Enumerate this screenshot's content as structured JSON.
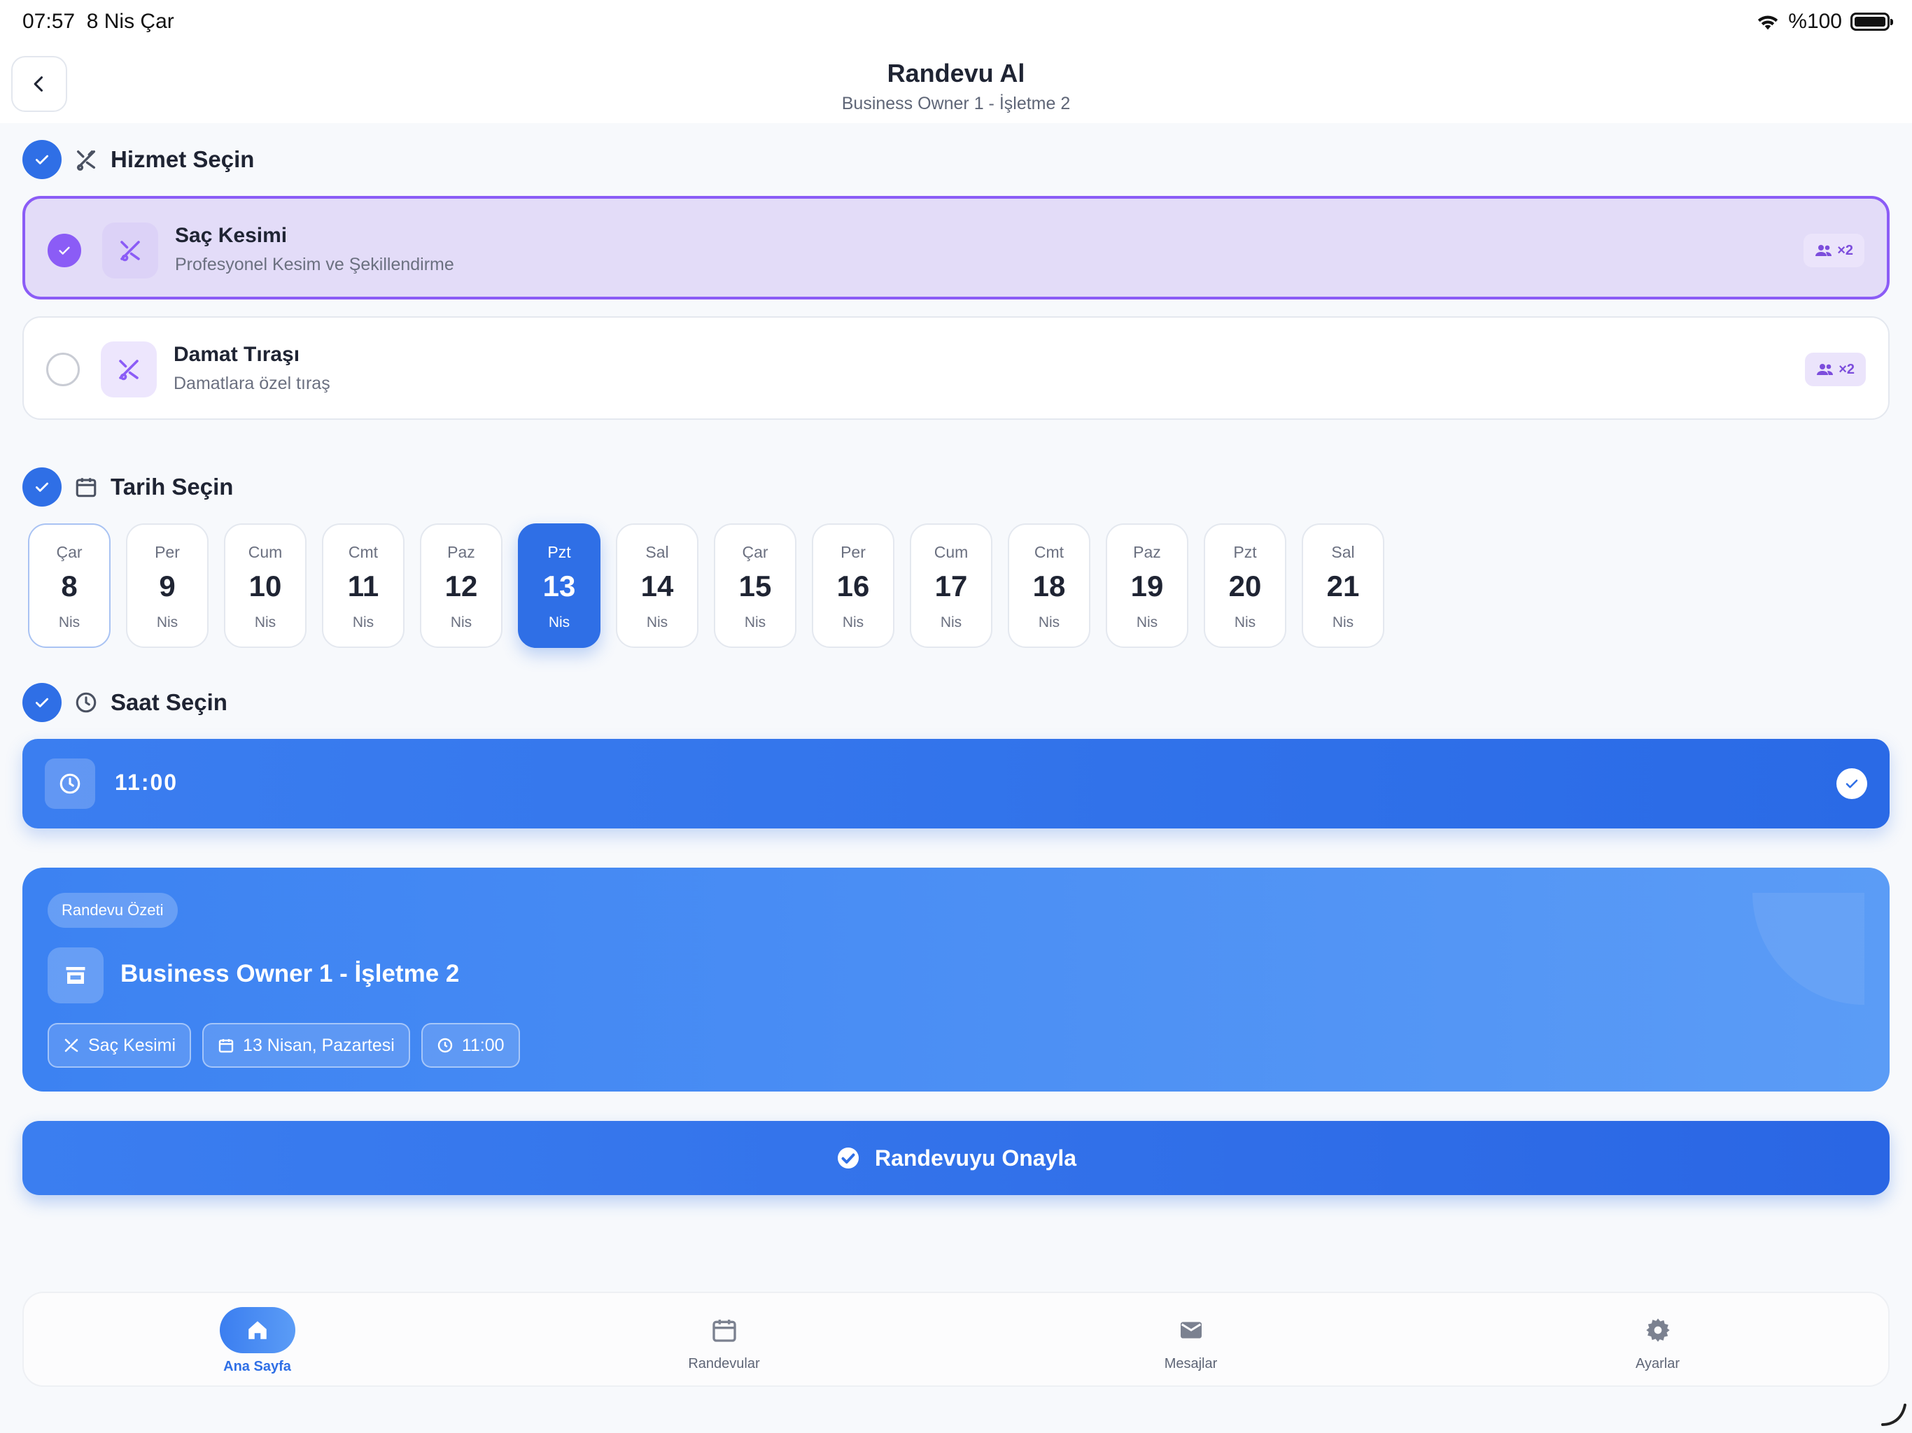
{
  "status": {
    "time": "07:57",
    "date": "8 Nis Çar",
    "battery": "%100"
  },
  "header": {
    "title": "Randevu Al",
    "subtitle": "Business Owner 1 - İşletme 2"
  },
  "sections": {
    "service": "Hizmet Seçin",
    "date": "Tarih Seçin",
    "time": "Saat Seçin"
  },
  "services": [
    {
      "name": "Saç Kesimi",
      "desc": "Profesyonel Kesim ve Şekillendirme",
      "badge": "×2",
      "selected": true
    },
    {
      "name": "Damat Tıraşı",
      "desc": "Damatlara özel tıraş",
      "badge": "×2",
      "selected": false
    }
  ],
  "dates": [
    {
      "dw": "Çar",
      "dn": "8",
      "dm": "Nis"
    },
    {
      "dw": "Per",
      "dn": "9",
      "dm": "Nis"
    },
    {
      "dw": "Cum",
      "dn": "10",
      "dm": "Nis"
    },
    {
      "dw": "Cmt",
      "dn": "11",
      "dm": "Nis"
    },
    {
      "dw": "Paz",
      "dn": "12",
      "dm": "Nis"
    },
    {
      "dw": "Pzt",
      "dn": "13",
      "dm": "Nis"
    },
    {
      "dw": "Sal",
      "dn": "14",
      "dm": "Nis"
    },
    {
      "dw": "Çar",
      "dn": "15",
      "dm": "Nis"
    },
    {
      "dw": "Per",
      "dn": "16",
      "dm": "Nis"
    },
    {
      "dw": "Cum",
      "dn": "17",
      "dm": "Nis"
    },
    {
      "dw": "Cmt",
      "dn": "18",
      "dm": "Nis"
    },
    {
      "dw": "Paz",
      "dn": "19",
      "dm": "Nis"
    },
    {
      "dw": "Pzt",
      "dn": "20",
      "dm": "Nis"
    },
    {
      "dw": "Sal",
      "dn": "21",
      "dm": "Nis"
    }
  ],
  "selected_time": "11:00",
  "summary": {
    "pill": "Randevu Özeti",
    "business": "Business Owner 1 - İşletme 2",
    "tag_service": "Saç Kesimi",
    "tag_date": "13 Nisan, Pazartesi",
    "tag_time": "11:00"
  },
  "confirm_label": "Randevuyu Onayla",
  "tabs": [
    {
      "label": "Ana Sayfa",
      "icon": "home-icon"
    },
    {
      "label": "Randevular",
      "icon": "calendar-icon"
    },
    {
      "label": "Mesajlar",
      "icon": "mail-icon"
    },
    {
      "label": "Ayarlar",
      "icon": "gear-icon"
    }
  ],
  "colors": {
    "primary": "#2f6fe6",
    "purple": "#8b5cf6",
    "background": "#f7f9fc"
  }
}
